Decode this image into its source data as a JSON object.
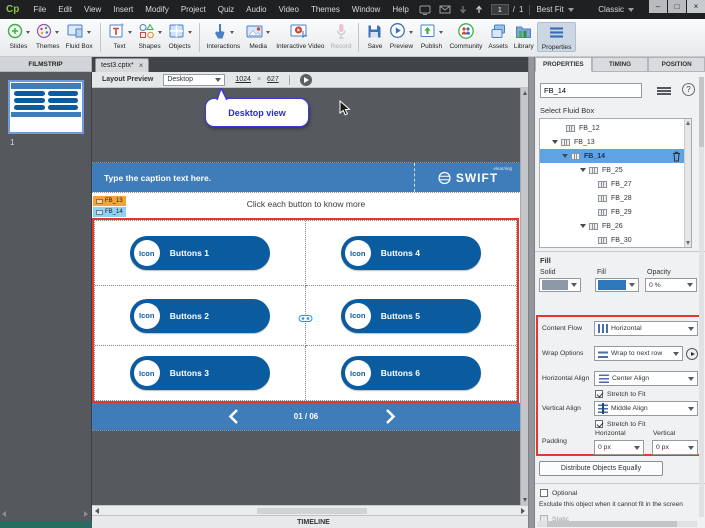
{
  "glyphs": {
    "close_x": "×",
    "help": "?",
    "minimize": "–",
    "maximize": "□",
    "win_close": "×",
    "multiply": "×",
    "slash": "/"
  },
  "menubar": {
    "logo": "Cp",
    "items": [
      "File",
      "Edit",
      "View",
      "Insert",
      "Modify",
      "Project",
      "Quiz",
      "Audio",
      "Video",
      "Themes",
      "Window",
      "Help"
    ],
    "slide_current": "1",
    "slide_total": "1",
    "fit": "Best Fit",
    "workspace": "Classic"
  },
  "toolbar": {
    "items": [
      "Slides",
      "Themes",
      "Fluid Box",
      "Text",
      "Shapes",
      "Objects",
      "Interactions",
      "Media",
      "Interactive Video",
      "Record",
      "Save",
      "Preview",
      "Publish",
      "Community",
      "Assets",
      "Library",
      "Properties"
    ]
  },
  "filmstrip": {
    "header": "FILMSTRIP",
    "slide_number": "1"
  },
  "doc": {
    "tab": "test3.cptx*"
  },
  "preview_bar": {
    "label": "Layout Preview",
    "device": "Desktop",
    "width": "1024",
    "height": "627"
  },
  "callout": {
    "text": "Desktop view"
  },
  "slide": {
    "caption": "Type the caption text here.",
    "brand": "SWIFT",
    "brand_super": "elearning",
    "instruction": "Click each button to know more",
    "tag1": "FB_13",
    "tag2": "FB_14",
    "icon_label": "Icon",
    "buttons": [
      "Buttons 1",
      "Buttons 2",
      "Buttons 3",
      "Buttons 4",
      "Buttons 5",
      "Buttons 6"
    ],
    "pager": "01 / 06"
  },
  "timeline_label": "TIMELINE",
  "panel": {
    "tabs": [
      "PROPERTIES",
      "TIMING",
      "POSITION"
    ],
    "name_value": "FB_14",
    "select_label": "Select Fluid Box",
    "tree": [
      {
        "label": "FB_12"
      },
      {
        "label": "FB_13"
      },
      {
        "label": "FB_14"
      },
      {
        "label": "FB_25"
      },
      {
        "label": "FB_27"
      },
      {
        "label": "FB_28"
      },
      {
        "label": "FB_29"
      },
      {
        "label": "FB_26"
      },
      {
        "label": "FB_30"
      }
    ],
    "fill_section": "Fill",
    "solid_label": "Solid",
    "fill_label": "Fill",
    "opacity_label": "Opacity",
    "opacity_value": "0 %",
    "content_flow_label": "Content Flow",
    "content_flow_value": "Horizontal",
    "wrap_label": "Wrap Options",
    "wrap_value": "Wrap to next row",
    "h_align_label": "Horizontal Align",
    "h_align_value": "Center Align",
    "stretch_label": "Stretch to Fit",
    "v_align_label": "Vertical Align",
    "v_align_value": "Middle Align",
    "padding_label": "Padding",
    "padding_h": "Horizontal",
    "padding_v": "Vertical",
    "padding_h_value": "0 px",
    "padding_v_value": "0 px",
    "distribute": "Distribute Objects Equally",
    "optional": "Optional",
    "exclude_note": "Exclude this object when it cannot fit in the screen",
    "static_label": "Static"
  },
  "colors": {
    "accent_blue": "#3e7cba",
    "button_blue": "#0b5c9f",
    "annotation_red": "#e5372b",
    "tag_orange": "#f2a33c",
    "tag_blue": "#8fd1f2",
    "tree_selection": "#5ea3e3",
    "callout_text": "#2b2bd0",
    "logo_green": "#8dc63f"
  }
}
